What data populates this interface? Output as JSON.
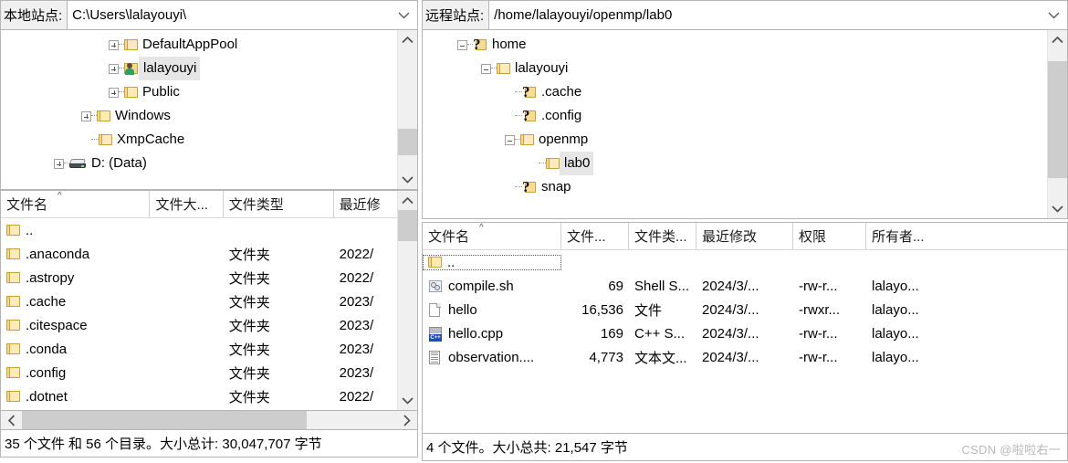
{
  "local": {
    "path_label": "本地站点:",
    "path_value": "C:\\Users\\lalayouyi\\",
    "tree": [
      {
        "label": "DefaultAppPool",
        "icon": "folder-icon",
        "expander": "plus",
        "depth": 3
      },
      {
        "label": "lalayouyi",
        "icon": "user-folder-icon",
        "expander": "plus",
        "depth": 3,
        "selected": true
      },
      {
        "label": "Public",
        "icon": "folder-icon",
        "expander": "plus",
        "depth": 3
      },
      {
        "label": "Windows",
        "icon": "folder-icon",
        "expander": "plus",
        "depth": 2
      },
      {
        "label": "XmpCache",
        "icon": "folder-icon",
        "expander": "none",
        "depth": 2
      },
      {
        "label": "D: (Data)",
        "icon": "drive-icon",
        "expander": "plus",
        "depth": 1
      }
    ],
    "columns": [
      "文件名",
      "文件大...",
      "文件类型",
      "最近修"
    ],
    "rows": [
      {
        "name": "..",
        "size": "",
        "type": "",
        "modified": "",
        "icon": "folder-icon"
      },
      {
        "name": ".anaconda",
        "size": "",
        "type": "文件夹",
        "modified": "2022/",
        "icon": "folder-icon"
      },
      {
        "name": ".astropy",
        "size": "",
        "type": "文件夹",
        "modified": "2022/",
        "icon": "folder-icon"
      },
      {
        "name": ".cache",
        "size": "",
        "type": "文件夹",
        "modified": "2023/",
        "icon": "folder-icon"
      },
      {
        "name": ".citespace",
        "size": "",
        "type": "文件夹",
        "modified": "2023/",
        "icon": "folder-icon"
      },
      {
        "name": ".conda",
        "size": "",
        "type": "文件夹",
        "modified": "2023/",
        "icon": "folder-icon"
      },
      {
        "name": ".config",
        "size": "",
        "type": "文件夹",
        "modified": "2023/",
        "icon": "folder-icon"
      },
      {
        "name": ".dotnet",
        "size": "",
        "type": "文件夹",
        "modified": "2022/",
        "icon": "folder-icon"
      }
    ],
    "status": "35 个文件 和 56 个目录。大小总计: 30,047,707 字节"
  },
  "remote": {
    "path_label": "远程站点:",
    "path_value": "/home/lalayouyi/openmp/lab0",
    "tree": [
      {
        "label": "home",
        "icon": "question-folder-icon",
        "expander": "minus",
        "depth": 1
      },
      {
        "label": "lalayouyi",
        "icon": "folder-icon",
        "expander": "minus",
        "depth": 2
      },
      {
        "label": ".cache",
        "icon": "question-folder-icon",
        "expander": "none",
        "depth": 3
      },
      {
        "label": ".config",
        "icon": "question-folder-icon",
        "expander": "none",
        "depth": 3
      },
      {
        "label": "openmp",
        "icon": "folder-icon",
        "expander": "minus",
        "depth": 3
      },
      {
        "label": "lab0",
        "icon": "folder-icon",
        "expander": "none",
        "depth": 4,
        "selected": true
      },
      {
        "label": "snap",
        "icon": "question-folder-icon",
        "expander": "none",
        "depth": 3
      }
    ],
    "columns": [
      "文件名",
      "文件...",
      "文件类...",
      "最近修改",
      "权限",
      "所有者..."
    ],
    "rows": [
      {
        "name": "..",
        "size": "",
        "type": "",
        "modified": "",
        "perms": "",
        "owner": "",
        "icon": "folder-icon",
        "focused": true
      },
      {
        "name": "compile.sh",
        "size": "69",
        "type": "Shell S...",
        "modified": "2024/3/...",
        "perms": "-rw-r...",
        "owner": "lalayo...",
        "icon": "shell-script-icon"
      },
      {
        "name": "hello",
        "size": "16,536",
        "type": "文件",
        "modified": "2024/3/...",
        "perms": "-rwxr...",
        "owner": "lalayo...",
        "icon": "generic-file-icon"
      },
      {
        "name": "hello.cpp",
        "size": "169",
        "type": "C++ S...",
        "modified": "2024/3/...",
        "perms": "-rw-r...",
        "owner": "lalayo...",
        "icon": "cpp-source-icon"
      },
      {
        "name": "observation....",
        "size": "4,773",
        "type": "文本文...",
        "modified": "2024/3/...",
        "perms": "-rw-r...",
        "owner": "lalayo...",
        "icon": "text-file-icon"
      }
    ],
    "status": "4 个文件。大小总共: 21,547 字节"
  },
  "watermark": "CSDN @啦啦右一"
}
